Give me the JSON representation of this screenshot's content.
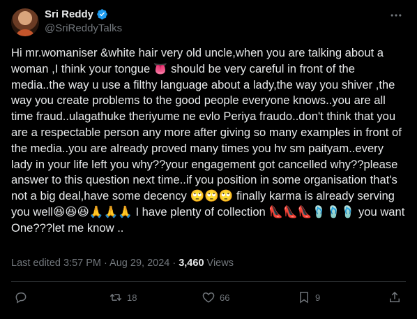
{
  "author": {
    "display_name": "Sri Reddy",
    "handle": "@SriReddyTalks",
    "verified": true
  },
  "tweet": {
    "text": "Hi mr.womaniser &white hair very old uncle,when you are talking about a woman ,I think your tongue 👅 should be very careful  in front of the media..the way u use a filthy language about a lady,the way you shiver ,the way you create problems to the good people everyone knows..you are all time fraud..ulagathuke theriyume ne evlo Periya fraudo..don't think that you are a respectable person any more after giving so many examples in front of the media..you are already proved many times you hv sm paityam..every lady in your life left you why??your engagement got cancelled why??please answer to this question next time..if you position in some organisation that's not a big deal,have some decency 🙄🙄🙄 finally karma is already serving you well😆😆😆🙏🙏🙏 I have plenty of collection 👠👠👠🩴🩴🩴 you want One???let me know ..",
    "edited_label": "Last edited 3:57 PM · Aug 29, 2024 · ",
    "views_count": "3,460",
    "views_label": " Views"
  },
  "actions": {
    "reply": "",
    "retweet": "18",
    "like": "66",
    "bookmark": "9"
  },
  "colors": {
    "background": "#000000",
    "text": "#e7e9ea",
    "secondary": "#71767b",
    "verified": "#1d9bf0",
    "divider": "#2f3336"
  }
}
